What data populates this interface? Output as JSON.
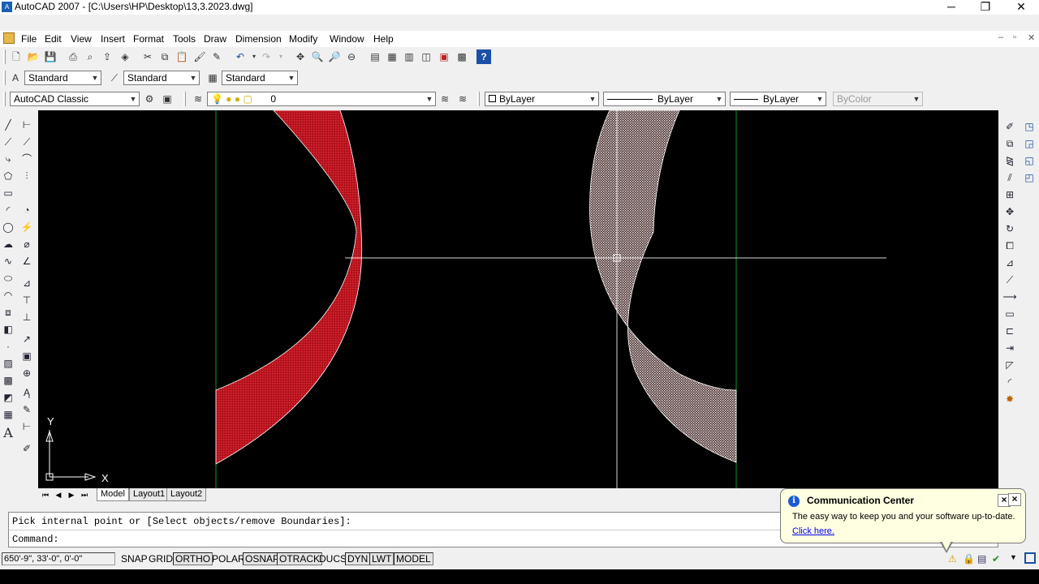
{
  "window": {
    "title": "AutoCAD 2007 - [C:\\Users\\HP\\Desktop\\13,3.2023.dwg]",
    "minimize": "─",
    "restore": "❐",
    "close": "✕"
  },
  "menubar": {
    "items": [
      "File",
      "Edit",
      "View",
      "Insert",
      "Format",
      "Tools",
      "Draw",
      "Dimension",
      "Modify",
      "Window",
      "Help"
    ],
    "doc_controls": [
      "–",
      "▫",
      "✕"
    ]
  },
  "styles_toolbar": {
    "text_style": "Standard",
    "dim_style": "Standard",
    "table_style": "Standard"
  },
  "workspace": {
    "value": "AutoCAD Classic"
  },
  "layers": {
    "current": "0"
  },
  "properties": {
    "color": "ByLayer",
    "linetype": "ByLayer",
    "lineweight": "ByLayer",
    "plotstyle": "ByColor"
  },
  "ucs": {
    "x_label": "X",
    "y_label": "Y"
  },
  "tabs": [
    "Model",
    "Layout1",
    "Layout2"
  ],
  "command": {
    "history": "Pick internal point or [Select objects/remove Boundaries]:",
    "prompt": "Command:"
  },
  "status": {
    "coords": "650'-9\", 33'-0\", 0'-0\"",
    "toggles": [
      "SNAP",
      "GRID",
      "ORTHO",
      "POLAR",
      "OSNAP",
      "OTRACK",
      "DUCS",
      "DYN",
      "LWT",
      "MODEL"
    ]
  },
  "balloon": {
    "title": "Communication Center",
    "body": "The easy way to keep you and your software up-to-date.",
    "link": "Click here."
  },
  "colors": {
    "hatch_red": "#c8141e",
    "hatch_white": "#e8d6d6",
    "construction_line": "#0a9a2a",
    "crosshair": "#ffffff"
  }
}
